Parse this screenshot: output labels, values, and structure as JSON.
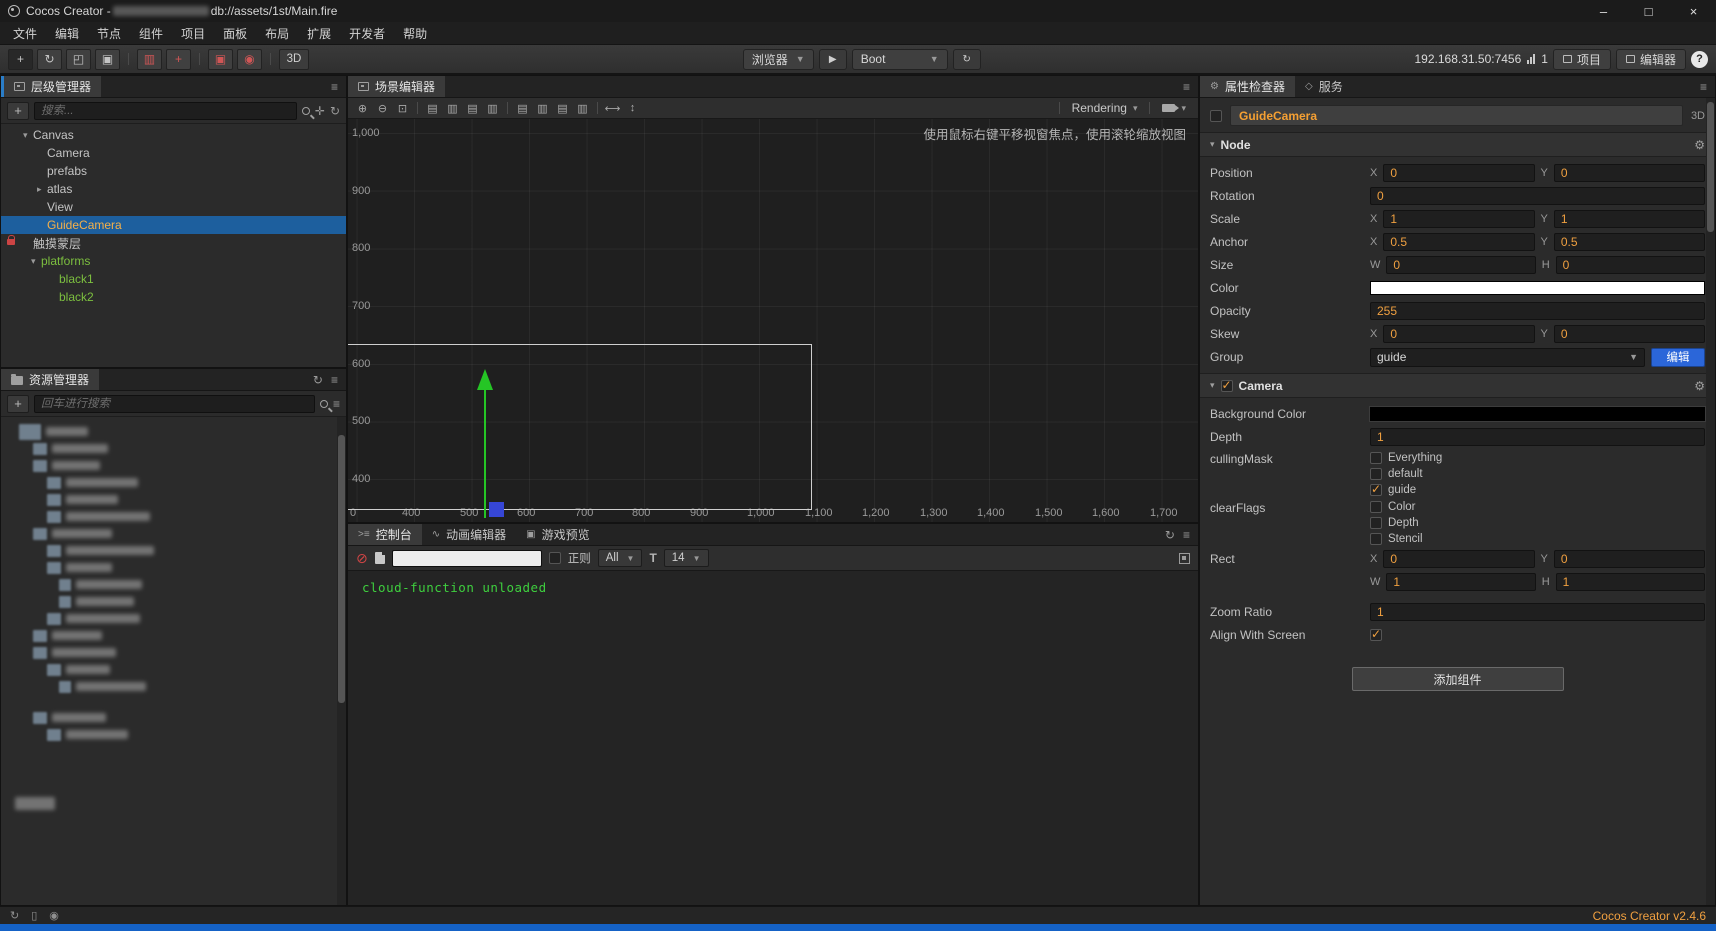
{
  "titlebar": {
    "title_prefix": "Cocos Creator - ",
    "file_path": "db://assets/1st/Main.fire"
  },
  "menubar": {
    "items": [
      "文件",
      "编辑",
      "节点",
      "组件",
      "项目",
      "面板",
      "布局",
      "扩展",
      "开发者",
      "帮助"
    ]
  },
  "toolbar": {
    "mode_label": "3D",
    "preview_browser_label": "浏览器",
    "scene_label": "Boot",
    "ip": "192.168.31.50:7456",
    "device_count": "1",
    "project_label": "项目",
    "editor_label": "编辑器",
    "help_label": "?"
  },
  "hierarchy": {
    "title": "层级管理器",
    "search_placeholder": "搜索...",
    "nodes": [
      {
        "label": "Canvas"
      },
      {
        "label": "Camera"
      },
      {
        "label": "prefabs"
      },
      {
        "label": "atlas"
      },
      {
        "label": "View"
      },
      {
        "label": "GuideCamera"
      },
      {
        "label": "触摸蒙层"
      },
      {
        "label": "platforms"
      },
      {
        "label": "black1"
      },
      {
        "label": "black2"
      }
    ]
  },
  "assets": {
    "title": "资源管理器",
    "search_placeholder": "回车进行搜索"
  },
  "scene": {
    "tab_label": "场景编辑器",
    "rendering_label": "Rendering",
    "hint": "使用鼠标右键平移视窗焦点，使用滚轮缩放视图",
    "ruler_y": [
      "1,000",
      "900",
      "800",
      "700",
      "600",
      "500",
      "400"
    ],
    "ruler_x": [
      "0",
      "400",
      "500",
      "600",
      "700",
      "800",
      "900",
      "1,000",
      "1,100",
      "1,200",
      "1,300",
      "1,400",
      "1,500",
      "1,600",
      "1,700"
    ]
  },
  "console": {
    "tabs": [
      "控制台",
      "动画编辑器",
      "游戏预览"
    ],
    "regex_label": "正则",
    "filter_value": "All",
    "font_icon": "T",
    "font_size_value": "14",
    "log_lines": [
      "cloud-function unloaded"
    ]
  },
  "inspector": {
    "tabs": [
      "属性检查器",
      "服务"
    ],
    "node_name": "GuideCamera",
    "mode_label": "3D",
    "axis_x": "X",
    "axis_y": "Y",
    "axis_w": "W",
    "axis_h": "H",
    "node": {
      "title": "Node",
      "position_label": "Position",
      "position_x": "0",
      "position_y": "0",
      "rotation_label": "Rotation",
      "rotation": "0",
      "scale_label": "Scale",
      "scale_x": "1",
      "scale_y": "1",
      "anchor_label": "Anchor",
      "anchor_x": "0.5",
      "anchor_y": "0.5",
      "size_label": "Size",
      "size_w": "0",
      "size_h": "0",
      "color_label": "Color",
      "color_value": "#ffffff",
      "opacity_label": "Opacity",
      "opacity": "255",
      "skew_label": "Skew",
      "skew_x": "0",
      "skew_y": "0",
      "group_label": "Group",
      "group_value": "guide",
      "group_edit_label": "编辑"
    },
    "camera": {
      "title": "Camera",
      "background_color_label": "Background Color",
      "background_color": "#000000",
      "depth_label": "Depth",
      "depth": "1",
      "culling_mask_label": "cullingMask",
      "culling_options": [
        {
          "label": "Everything",
          "checked": false
        },
        {
          "label": "default",
          "checked": false
        },
        {
          "label": "guide",
          "checked": true
        }
      ],
      "clear_flags_label": "clearFlags",
      "clear_options": [
        {
          "label": "Color",
          "checked": false
        },
        {
          "label": "Depth",
          "checked": false
        },
        {
          "label": "Stencil",
          "checked": false
        }
      ],
      "rect_label": "Rect",
      "rect_x": "0",
      "rect_y": "0",
      "rect_w": "1",
      "rect_h": "1",
      "zoom_label": "Zoom Ratio",
      "zoom": "1",
      "align_label": "Align With Screen",
      "align_checked": true
    },
    "add_component_label": "添加组件"
  },
  "statusbar": {
    "version": "Cocos Creator v2.4.6"
  }
}
